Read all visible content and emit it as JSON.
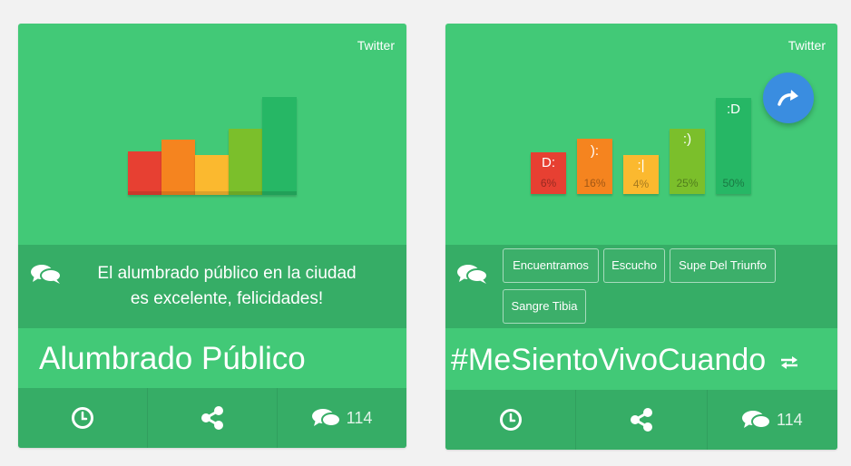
{
  "cards": [
    {
      "source": "Twitter",
      "chart_bars": [
        {
          "color": "#e74032"
        },
        {
          "color": "#f5841f"
        },
        {
          "color": "#fbb92f"
        },
        {
          "color": "#7bbf2b"
        },
        {
          "color": "#26b765"
        }
      ],
      "comment": [
        "El alumbrado público en la ciudad",
        "es excelente, felicidades!"
      ],
      "title": "Alumbrado Público",
      "footer": {
        "history_icon": "clock-icon",
        "share_icon": "share-icon",
        "comments_count": "114"
      }
    },
    {
      "source": "Twitter",
      "sentiment_bars": [
        {
          "face": "D:",
          "pct": "6%",
          "value": 6,
          "color": "#e74032"
        },
        {
          "face": "):",
          "pct": "16%",
          "value": 16,
          "color": "#f5841f"
        },
        {
          "face": ":|",
          "pct": "4%",
          "value": 4,
          "color": "#fbb92f"
        },
        {
          "face": ":)",
          "pct": "25%",
          "value": 25,
          "color": "#7bbf2b"
        },
        {
          "face": ":D",
          "pct": "50%",
          "value": 50,
          "color": "#26b765"
        }
      ],
      "chips": [
        "Encuentramos",
        "Escucho",
        "Supe Del Triunfo",
        "Sangre Tibia"
      ],
      "title": "#MeSientoVivoCuando",
      "footer": {
        "history_icon": "clock-icon",
        "share_icon": "share-icon",
        "comments_count": "114"
      }
    }
  ]
}
